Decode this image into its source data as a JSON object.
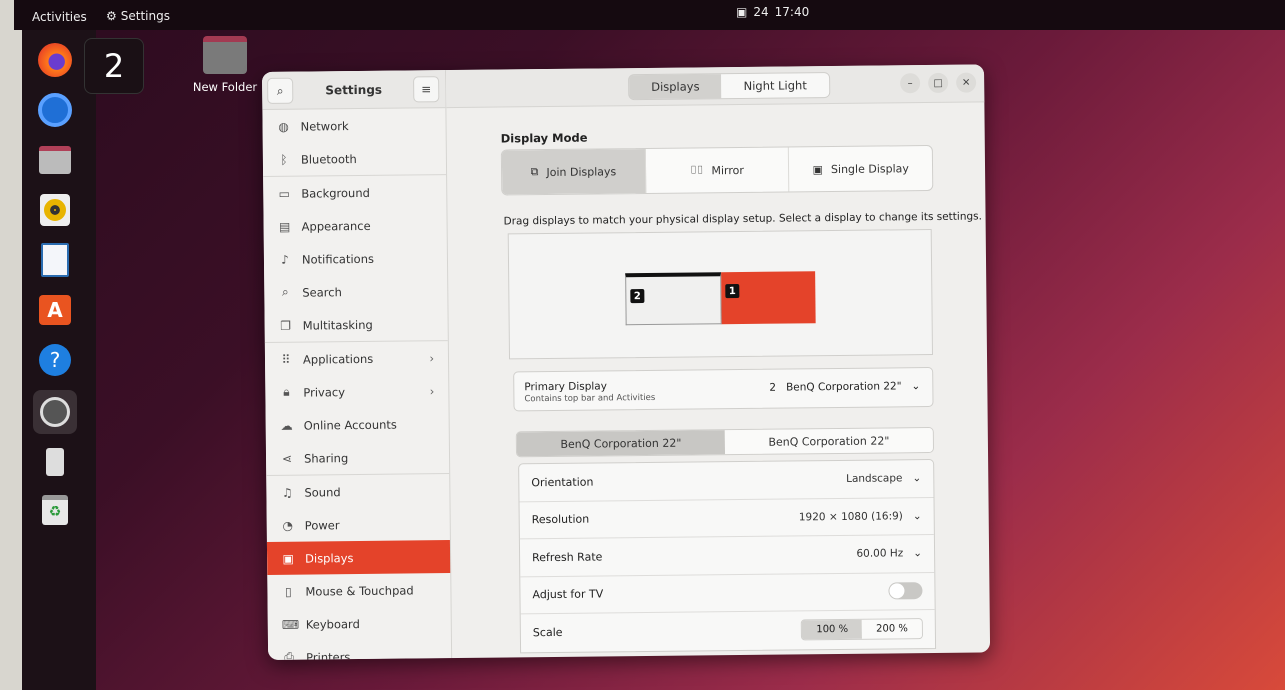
{
  "topbar": {
    "activities": "Activities",
    "app_name": "Settings",
    "clock_date": "24",
    "clock_time": "17:40"
  },
  "workspace": {
    "number": "2"
  },
  "desktop": {
    "folder_label": "New Folder"
  },
  "dock": {
    "items": [
      "firefox",
      "thunderbird",
      "files",
      "rhythmbox",
      "libreoffice-writer",
      "app-center",
      "help",
      "settings",
      "usb-drive",
      "trash"
    ],
    "active": "settings"
  },
  "window": {
    "sidebar": {
      "title": "Settings",
      "items": [
        {
          "label": "Network",
          "icon": "network-icon"
        },
        {
          "label": "Bluetooth",
          "icon": "bluetooth-icon"
        },
        {
          "label": "Background",
          "icon": "background-icon"
        },
        {
          "label": "Appearance",
          "icon": "appearance-icon"
        },
        {
          "label": "Notifications",
          "icon": "bell-icon"
        },
        {
          "label": "Search",
          "icon": "search-icon"
        },
        {
          "label": "Multitasking",
          "icon": "multitasking-icon"
        },
        {
          "label": "Applications",
          "icon": "grid-icon",
          "has_chevron": true
        },
        {
          "label": "Privacy",
          "icon": "lock-icon",
          "has_chevron": true
        },
        {
          "label": "Online Accounts",
          "icon": "cloud-icon"
        },
        {
          "label": "Sharing",
          "icon": "share-icon"
        },
        {
          "label": "Sound",
          "icon": "music-icon"
        },
        {
          "label": "Power",
          "icon": "power-icon"
        },
        {
          "label": "Displays",
          "icon": "display-icon",
          "selected": true
        },
        {
          "label": "Mouse & Touchpad",
          "icon": "mouse-icon"
        },
        {
          "label": "Keyboard",
          "icon": "keyboard-icon"
        },
        {
          "label": "Printers",
          "icon": "printer-icon"
        }
      ]
    },
    "header": {
      "tabs": [
        {
          "label": "Displays",
          "active": true
        },
        {
          "label": "Night Light",
          "active": false
        }
      ]
    },
    "display_mode": {
      "title": "Display Mode",
      "options": [
        {
          "label": "Join Displays",
          "active": true
        },
        {
          "label": "Mirror",
          "active": false
        },
        {
          "label": "Single Display",
          "active": false
        }
      ]
    },
    "arrangement": {
      "hint": "Drag displays to match your physical display setup. Select a display to change its settings.",
      "monitors": [
        {
          "number": "2",
          "primary": true,
          "selected": false
        },
        {
          "number": "1",
          "primary": false,
          "selected": true
        }
      ],
      "accent": "#e4432a"
    },
    "primary_display": {
      "label": "Primary Display",
      "sub": "Contains top bar and Activities",
      "value_num": "2",
      "value_name": "BenQ Corporation 22\""
    },
    "monitor_tabs": [
      {
        "label": "BenQ Corporation 22\"",
        "active": true
      },
      {
        "label": "BenQ Corporation 22\"",
        "active": false
      }
    ],
    "settings": {
      "orientation": {
        "label": "Orientation",
        "value": "Landscape"
      },
      "resolution": {
        "label": "Resolution",
        "value": "1920 × 1080 (16:9)"
      },
      "refresh": {
        "label": "Refresh Rate",
        "value": "60.00 Hz"
      },
      "tv": {
        "label": "Adjust for TV",
        "on": false
      },
      "scale": {
        "label": "Scale",
        "options": [
          "100 %",
          "200 %"
        ],
        "selected": "100 %"
      }
    }
  }
}
